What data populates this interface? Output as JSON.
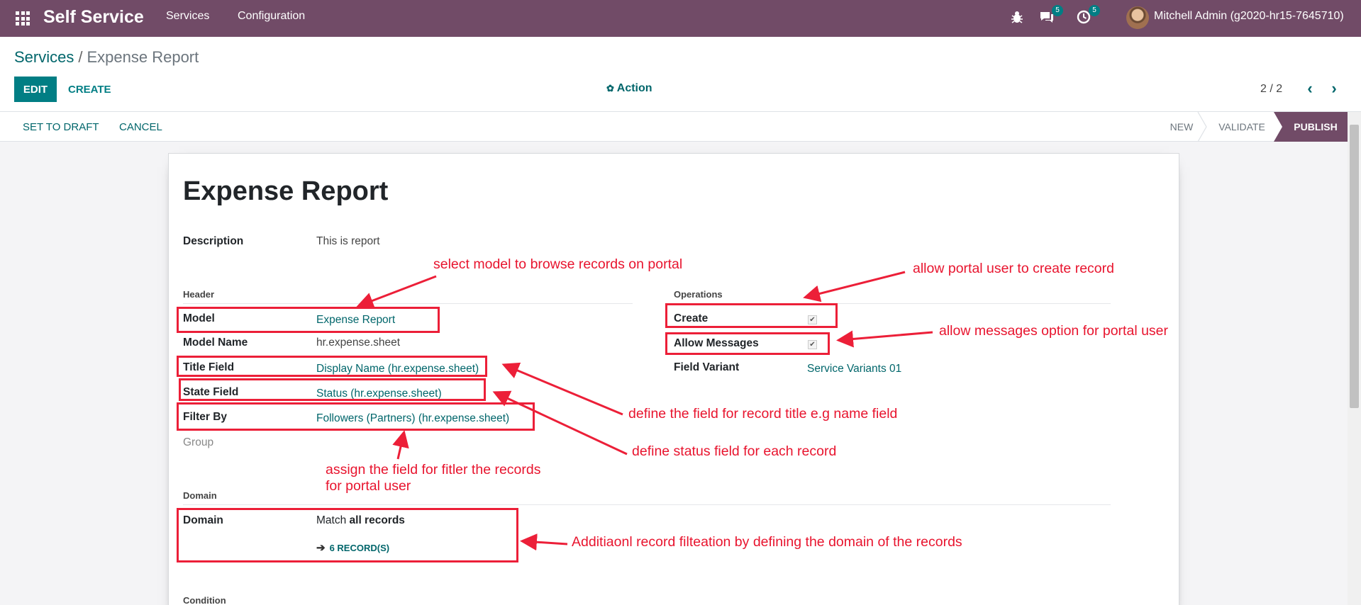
{
  "navbar": {
    "brand": "Self Service",
    "menu": [
      "Services",
      "Configuration"
    ],
    "messages_count": "5",
    "activities_count": "5",
    "user": "Mitchell Admin (g2020-hr15-7645710)"
  },
  "breadcrumb": {
    "parent": "Services",
    "separator": "/",
    "current": "Expense Report"
  },
  "buttons": {
    "edit": "EDIT",
    "create": "CREATE",
    "action": "Action"
  },
  "pager": {
    "value": "2 / 2"
  },
  "statusbar": {
    "buttons": [
      "SET TO DRAFT",
      "CANCEL"
    ],
    "stages": [
      "NEW",
      "VALIDATE",
      "PUBLISH"
    ],
    "active_stage": "PUBLISH"
  },
  "form": {
    "title": "Expense Report",
    "description_label": "Description",
    "description_value": "This is report",
    "header_section": "Header",
    "model_label": "Model",
    "model_value": "Expense Report",
    "model_name_label": "Model Name",
    "model_name_value": "hr.expense.sheet",
    "title_field_label": "Title Field",
    "title_field_value": "Display Name (hr.expense.sheet)",
    "state_field_label": "State Field",
    "state_field_value": "Status (hr.expense.sheet)",
    "filter_by_label": "Filter By",
    "filter_by_value": "Followers (Partners) (hr.expense.sheet)",
    "group_label": "Group",
    "operations_section": "Operations",
    "create_label": "Create",
    "allow_messages_label": "Allow Messages",
    "field_variant_label": "Field Variant",
    "field_variant_value": "Service Variants 01",
    "domain_section": "Domain",
    "domain_label": "Domain",
    "domain_match_prefix": "Match ",
    "domain_match_bold": "all records",
    "domain_records": "6 RECORD(S)",
    "condition_section": "Condition"
  },
  "annotations": {
    "model": "select model to browse records on portal",
    "create": "allow portal user to create record",
    "messages": "allow messages option for portal user",
    "title_field": "define the field for record title e.g name field",
    "state_field": "define status field for each record",
    "filter_line1": "assign the field for fitler the records",
    "filter_line2": "for portal user",
    "domain": "Additiaonl record filteation by defining the domain of the records"
  },
  "colors": {
    "brand": "#714b67",
    "accent": "#017e84",
    "annotation": "#ec1f38"
  }
}
